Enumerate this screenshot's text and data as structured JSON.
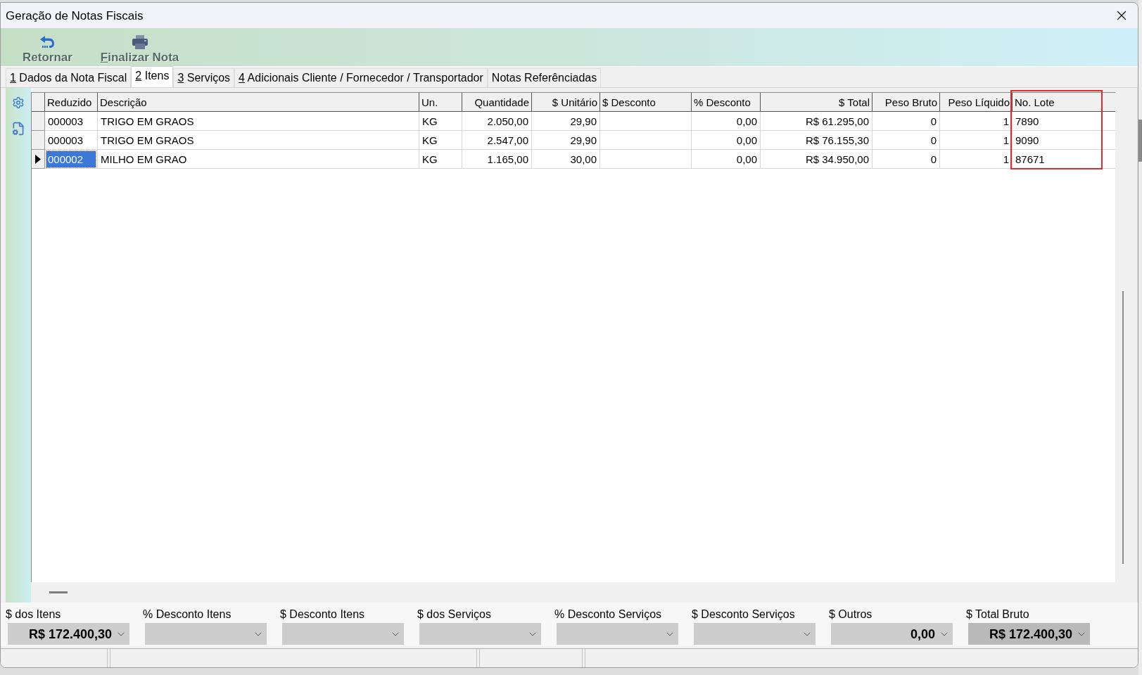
{
  "window": {
    "title": "Geração de Notas Fiscais"
  },
  "toolbar": [
    {
      "kind": "return",
      "label": "Retornar"
    },
    {
      "kind": "print",
      "mnemonic": "F",
      "label": "inalizar Nota"
    }
  ],
  "tabs": [
    {
      "mnemonic": "1",
      "label": "Dados da Nota Fiscal",
      "selected": false
    },
    {
      "mnemonic": "2",
      "label": "Itens",
      "selected": true
    },
    {
      "mnemonic": "3",
      "label": "Serviços",
      "selected": false
    },
    {
      "mnemonic": "4",
      "label": "Adicionais Cliente / Fornecedor / Transportador",
      "selected": false
    },
    {
      "label": "Notas Referênciadas",
      "selected": false
    }
  ],
  "table": {
    "columns": [
      {
        "label": "Reduzido",
        "highlighted": false
      },
      {
        "label": "Descrição",
        "highlighted": false
      },
      {
        "label": "Un.",
        "highlighted": false
      },
      {
        "label": "Quantidade",
        "highlighted": false
      },
      {
        "label": "$ Unitário",
        "highlighted": false
      },
      {
        "label": "$ Desconto",
        "highlighted": false
      },
      {
        "label": "% Desconto",
        "highlighted": false
      },
      {
        "label": "$ Total",
        "highlighted": false
      },
      {
        "label": "Peso Bruto",
        "highlighted": false
      },
      {
        "label": "Peso Líquido",
        "highlighted": false
      },
      {
        "label": "No. Lote",
        "highlighted": true
      }
    ],
    "rows": [
      {
        "selected": false,
        "cells": [
          "000003",
          "TRIGO EM GRAOS",
          "KG",
          "2.050,00",
          "29,90",
          null,
          "0,00",
          "R$ 61.295,00",
          "0",
          "1",
          "7890"
        ]
      },
      {
        "selected": false,
        "cells": [
          "000003",
          "TRIGO EM GRAOS",
          "KG",
          "2.547,00",
          "29,90",
          null,
          "0,00",
          "R$ 76.155,30",
          "0",
          "1",
          "9090"
        ]
      },
      {
        "selected": true,
        "cells": [
          "000002",
          "MILHO EM GRAO",
          "KG",
          "1.165,00",
          "30,00",
          null,
          "0,00",
          "R$ 34.950,00",
          "0",
          "1",
          "87671"
        ]
      }
    ]
  },
  "summary": [
    {
      "label": "$ dos Itens",
      "value": "R$ 172.400,30",
      "kind": "combo"
    },
    {
      "label": "% Desconto Itens",
      "kind": "combo"
    },
    {
      "label": "$ Desconto Itens",
      "kind": "combo"
    },
    {
      "label": "$ dos Serviços",
      "kind": "combo"
    },
    {
      "label": "% Desconto Serviços",
      "kind": "combo"
    },
    {
      "label": "$ Desconto Serviços",
      "kind": "combo"
    },
    {
      "label": "$ Outros",
      "value": "0,00",
      "kind": "combo"
    },
    {
      "label": "$ Total Bruto",
      "value": "R$ 172.400,30",
      "kind": "total"
    }
  ]
}
